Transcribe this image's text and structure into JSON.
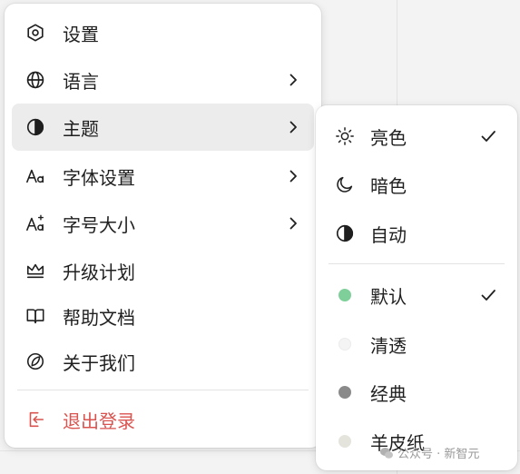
{
  "main_menu": {
    "items": [
      {
        "label": "设置",
        "icon": "settings-hexagon-icon",
        "has_submenu": false
      },
      {
        "label": "语言",
        "icon": "globe-icon",
        "has_submenu": true
      },
      {
        "label": "主题",
        "icon": "half-circle-contrast-icon",
        "has_submenu": true,
        "active": true
      },
      {
        "label": "字体设置",
        "icon": "font-aa-icon",
        "has_submenu": true
      },
      {
        "label": "字号大小",
        "icon": "font-size-sparkle-icon",
        "has_submenu": true
      },
      {
        "label": "升级计划",
        "icon": "crown-icon",
        "has_submenu": false
      },
      {
        "label": "帮助文档",
        "icon": "open-book-icon",
        "has_submenu": false
      },
      {
        "label": "关于我们",
        "icon": "leaf-circle-icon",
        "has_submenu": false
      },
      {
        "label": "退出登录",
        "icon": "logout-icon",
        "has_submenu": false,
        "danger": true
      }
    ]
  },
  "theme_submenu": {
    "modes": [
      {
        "label": "亮色",
        "icon": "sun-icon",
        "checked": true
      },
      {
        "label": "暗色",
        "icon": "moon-icon",
        "checked": false
      },
      {
        "label": "自动",
        "icon": "half-circle-contrast-icon",
        "checked": false
      }
    ],
    "palettes": [
      {
        "label": "默认",
        "color": "#7fcf9a",
        "checked": true
      },
      {
        "label": "清透",
        "color": "#f4f4f4",
        "checked": false
      },
      {
        "label": "经典",
        "color": "#8a8a8a",
        "checked": false
      },
      {
        "label": "羊皮纸",
        "color": "#e4e4dc",
        "checked": false
      }
    ]
  },
  "colors": {
    "danger": "#d9534f",
    "active_bg": "#ececec"
  },
  "watermark": {
    "text": "公众号 · 新智元"
  }
}
